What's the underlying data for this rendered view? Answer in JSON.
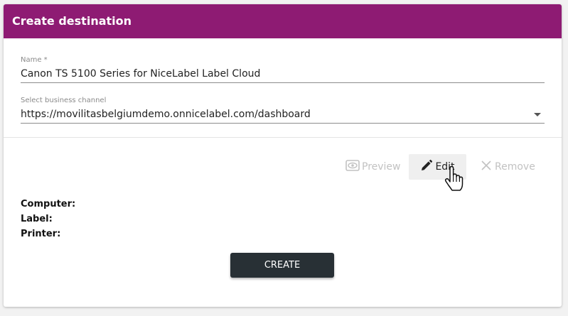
{
  "header": {
    "title": "Create destination"
  },
  "form": {
    "name": {
      "label": "Name *",
      "value": "Canon TS 5100 Series for NiceLabel Label Cloud"
    },
    "business_channel": {
      "label": "Select business channel",
      "value": "https://movilitasbelgiumdemo.onnicelabel.com/dashboard"
    }
  },
  "actions": {
    "preview": {
      "label": "Preview",
      "icon": "eye-icon",
      "enabled": false
    },
    "edit": {
      "label": "Edit",
      "icon": "pencil-icon",
      "enabled": true
    },
    "remove": {
      "label": "Remove",
      "icon": "close-icon",
      "enabled": false
    }
  },
  "details": {
    "computer_label": "Computer:",
    "label_label": "Label:",
    "printer_label": "Printer:"
  },
  "create_button": {
    "label": "CREATE"
  },
  "colors": {
    "header_bg": "#8e1b73",
    "button_bg": "#283035",
    "disabled_text": "#c2c2c2"
  }
}
